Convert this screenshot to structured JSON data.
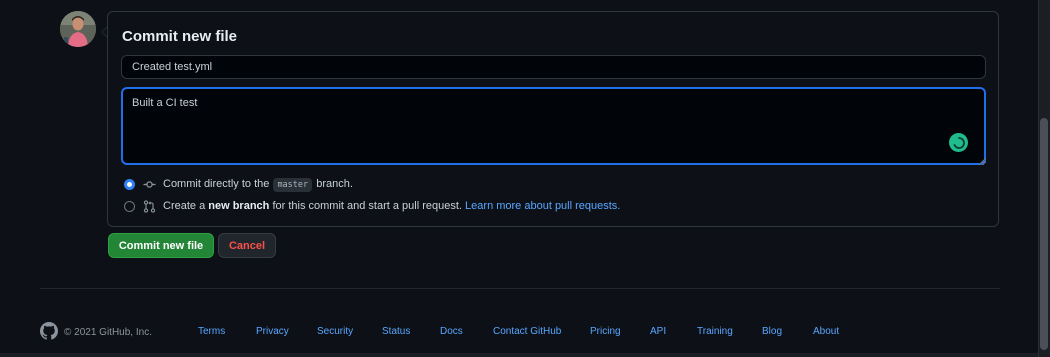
{
  "commit": {
    "title": "Commit new file",
    "summary_value": "Created test.yml",
    "description_value": "Built a CI test"
  },
  "options": {
    "direct": {
      "prefix": "Commit directly to the",
      "branch": "master",
      "suffix": "branch.",
      "selected": true
    },
    "new_branch": {
      "prefix": "Create a",
      "bold": "new branch",
      "middle": "for this commit and start a pull request.",
      "link": "Learn more about pull requests.",
      "selected": false
    }
  },
  "buttons": {
    "commit_label": "Commit new file",
    "cancel_label": "Cancel"
  },
  "footer": {
    "copyright": "© 2021 GitHub, Inc.",
    "links": [
      "Terms",
      "Privacy",
      "Security",
      "Status",
      "Docs",
      "Contact GitHub",
      "Pricing",
      "API",
      "Training",
      "Blog",
      "About"
    ]
  },
  "colors": {
    "background": "#0d1117",
    "primary_button": "#238636",
    "cancel_text": "#f85149",
    "link": "#58a6ff",
    "focus_border": "#1f6feb"
  },
  "icons": {
    "commit_direct": "git-commit-icon",
    "new_branch": "git-pull-request-icon",
    "footer_logo": "github-mark-icon",
    "extension_badge": "spinner-icon"
  }
}
